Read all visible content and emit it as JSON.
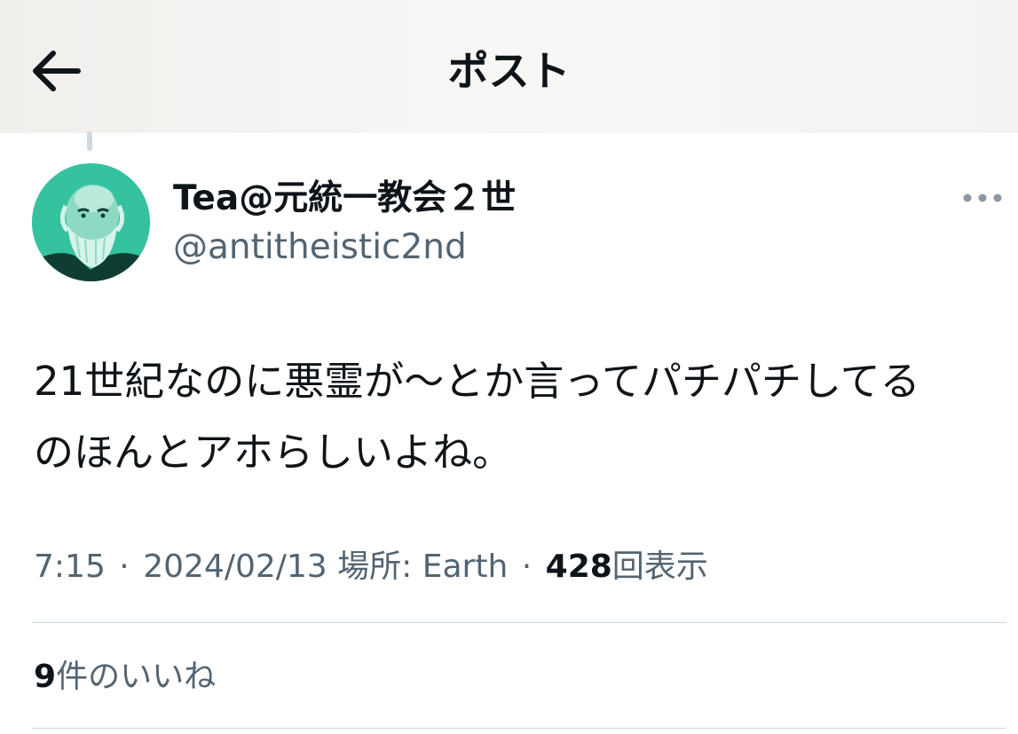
{
  "header": {
    "title": "ポスト",
    "back_icon": "arrow-left-icon"
  },
  "post": {
    "display_name": "Tea@元統一教会２世",
    "handle": "@antitheistic2nd",
    "more_icon": "more-dots-icon",
    "text": "21世紀なのに悪霊が〜とか言ってパチパチしてる\nのほんとアホらしいよね。",
    "time": "7:15",
    "date": "2024/02/13",
    "location_label": "場所: Earth",
    "views_count": "428",
    "views_label": "回表示",
    "separator": "·",
    "likes_count": "9",
    "likes_label": "件のいいね"
  },
  "colors": {
    "text_primary": "#0f1419",
    "text_secondary": "#536471",
    "divider": "#cfd9de",
    "avatar_bg": "#2fb897"
  }
}
